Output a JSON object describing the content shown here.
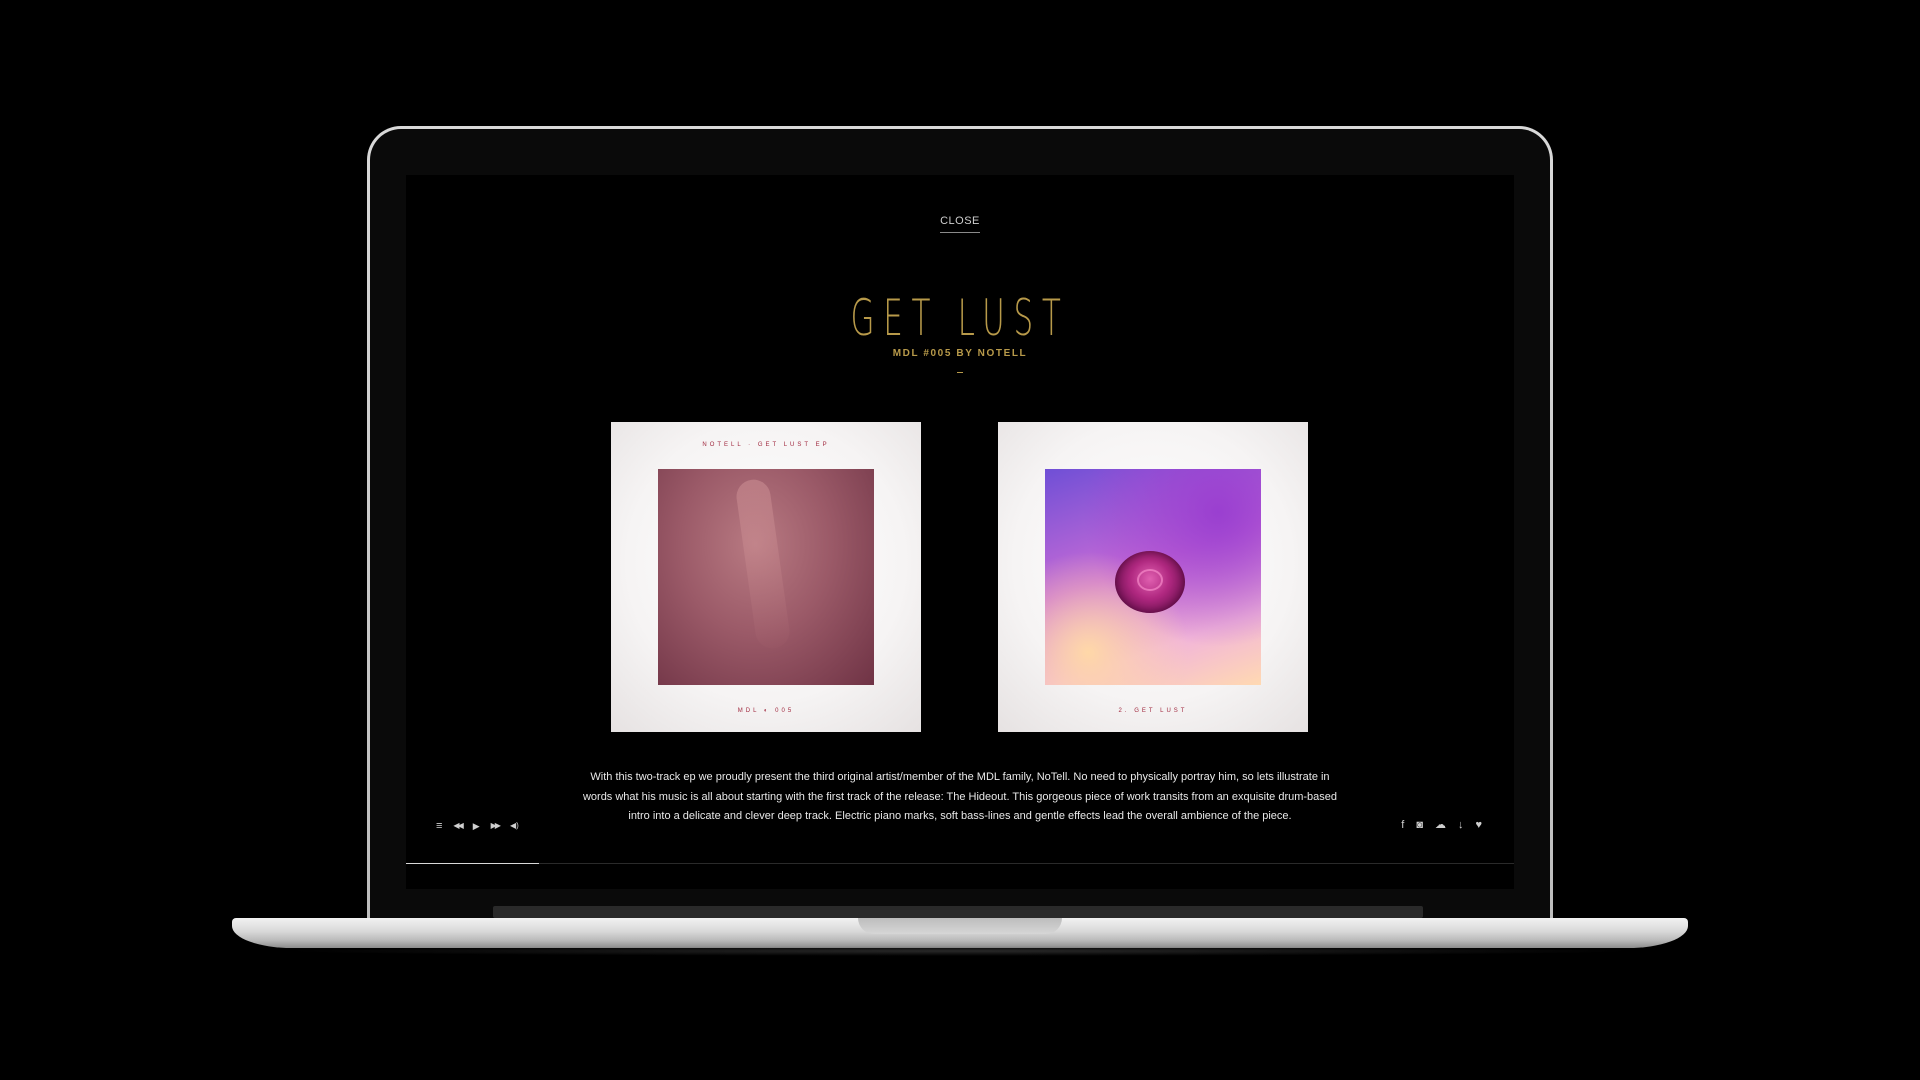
{
  "page": {
    "close_label": "CLOSE",
    "title": "GET LUST",
    "subtitle": "MDL #005 BY NOTELL",
    "description": "With this two-track ep we proudly present the third original artist/member of the MDL family, NoTell. No need to physically portray him, so lets illustrate in words what his music is all about starting with the first track of the release: The Hideout. This gorgeous piece of work transits from an exquisite drum-based intro into a delicate and clever deep track. Electric piano marks, soft bass-lines and gentle effects lead the overall ambience of the piece."
  },
  "covers": [
    {
      "top_text": "NOTELL · GET LUST EP",
      "bottom_text": "MDL ◐ 005"
    },
    {
      "top_text": "",
      "bottom_text": "2. GET LUST"
    }
  ],
  "player": {
    "controls": [
      {
        "name": "playlist-icon",
        "glyph": "≡"
      },
      {
        "name": "previous-icon",
        "glyph": "◀◀"
      },
      {
        "name": "play-icon",
        "glyph": "▶"
      },
      {
        "name": "next-icon",
        "glyph": "▶▶"
      },
      {
        "name": "volume-icon",
        "glyph": "◀)"
      }
    ],
    "progress": 0.12
  },
  "social": [
    {
      "name": "facebook-icon",
      "glyph": "f"
    },
    {
      "name": "instagram-icon",
      "glyph": "◙"
    },
    {
      "name": "soundcloud-icon",
      "glyph": "☁"
    },
    {
      "name": "download-icon",
      "glyph": "↓"
    },
    {
      "name": "heart-icon",
      "glyph": "♥"
    }
  ],
  "colors": {
    "accent_gold": "#b89a4a",
    "cover_text": "#a0283e",
    "background": "#000000"
  }
}
